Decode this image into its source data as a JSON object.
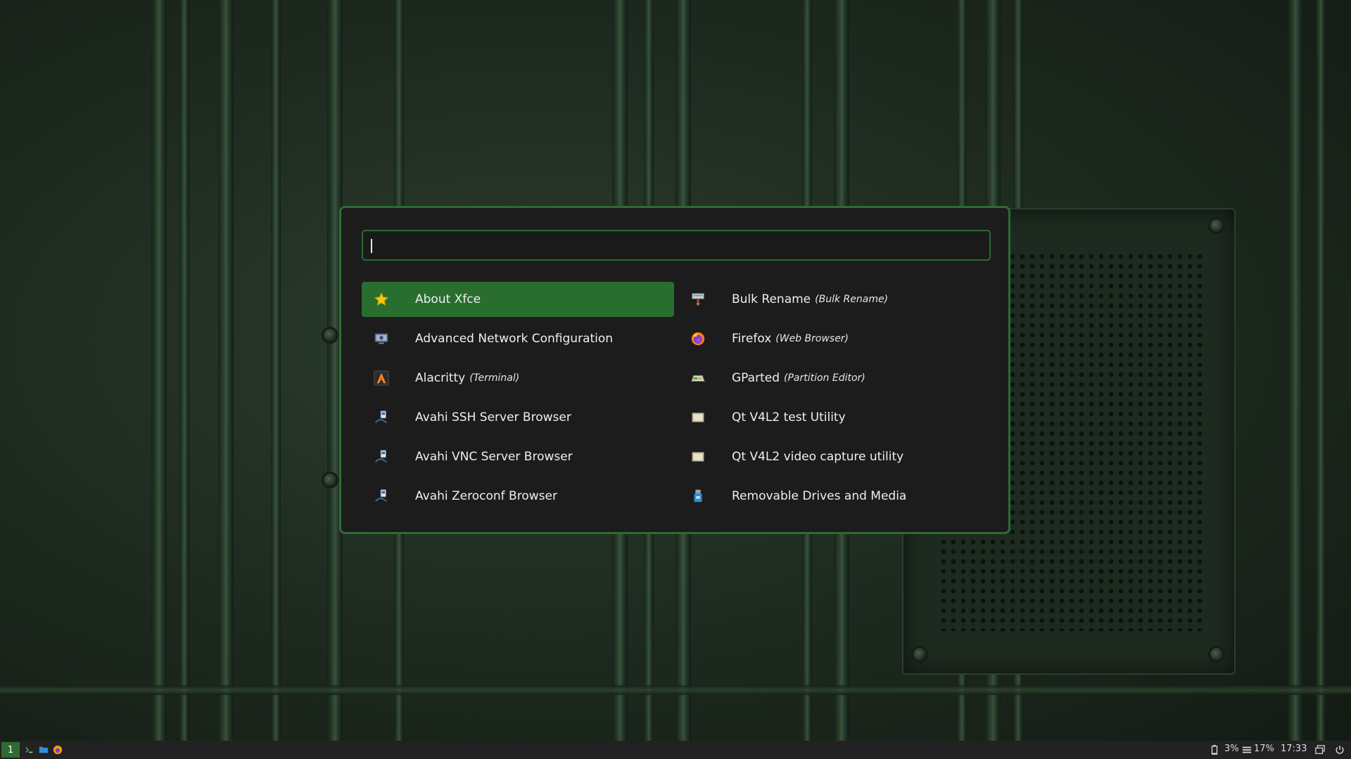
{
  "launcher": {
    "search": {
      "value": "",
      "placeholder": ""
    },
    "items": [
      {
        "name": "About Xfce",
        "generic": "",
        "icon": "star-icon"
      },
      {
        "name": "Advanced Network Configuration",
        "generic": "",
        "icon": "network-config-icon"
      },
      {
        "name": "Alacritty",
        "generic": "(Terminal)",
        "icon": "alacritty-icon"
      },
      {
        "name": "Avahi SSH Server Browser",
        "generic": "",
        "icon": "avahi-ssh-icon"
      },
      {
        "name": "Avahi VNC Server Browser",
        "generic": "",
        "icon": "avahi-vnc-icon"
      },
      {
        "name": "Avahi Zeroconf Browser",
        "generic": "",
        "icon": "avahi-zeroconf-icon"
      },
      {
        "name": "Bulk Rename",
        "generic": "(Bulk Rename)",
        "icon": "bulk-rename-icon"
      },
      {
        "name": "Firefox",
        "generic": "(Web Browser)",
        "icon": "firefox-icon"
      },
      {
        "name": "GParted",
        "generic": "(Partition Editor)",
        "icon": "gparted-icon"
      },
      {
        "name": "Qt V4L2 test Utility",
        "generic": "",
        "icon": "qv4l2-icon"
      },
      {
        "name": "Qt V4L2 video capture utility",
        "generic": "",
        "icon": "qvidcap-icon"
      },
      {
        "name": "Removable Drives and Media",
        "generic": "",
        "icon": "removable-drive-icon"
      }
    ],
    "selected_index": 0
  },
  "taskbar": {
    "workspace": "1",
    "launchers": [
      "terminal-icon",
      "folder-icon",
      "firefox-icon"
    ],
    "battery": "3%",
    "memory": "17%",
    "clock": "17:33"
  },
  "colors": {
    "accent": "#2e6b32",
    "selected_bg": "#2a6e2f",
    "window_bg": "#1c1c1c",
    "taskbar_bg": "#222222"
  }
}
